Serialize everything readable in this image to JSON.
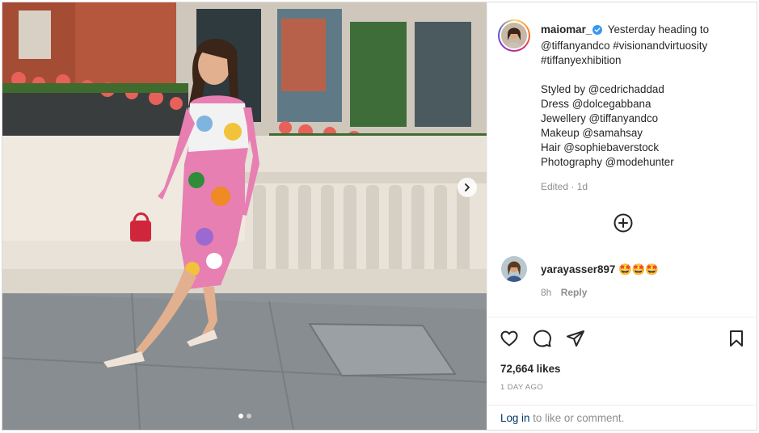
{
  "post": {
    "username": "maiomar_",
    "verified": true,
    "caption_lines": [
      "Yesterday heading to",
      "@tiffanyandco #visionandvirtuosity",
      "#tiffanyexhibition"
    ],
    "credits": [
      "Styled by @cedrichaddad",
      "Dress @dolcegabbana",
      "Jewellery @tiffanyandco",
      "Makeup @samahsay",
      "Hair @sophiebaverstock",
      "Photography @modehunter"
    ],
    "edited_label": "Edited · 1d"
  },
  "comment": {
    "username": "yarayasser897",
    "text": "🤩🤩🤩",
    "age": "8h",
    "reply_label": "Reply"
  },
  "stats": {
    "likes": "72,664 likes",
    "time_ago": "1 DAY AGO"
  },
  "login": {
    "link": "Log in",
    "rest": " to like or comment."
  },
  "carousel": {
    "current_index": 1,
    "total": 2
  },
  "icons": {
    "verified": "verified-badge-icon",
    "next": "chevron-right-icon",
    "more": "plus-circle-icon",
    "like": "heart-icon",
    "comment": "comment-bubble-icon",
    "share": "paper-plane-icon",
    "save": "bookmark-icon"
  },
  "colors": {
    "verified_blue": "#3897f0",
    "link_blue": "#00376b",
    "muted_text": "#8e8e8e",
    "primary_text": "#262626"
  }
}
